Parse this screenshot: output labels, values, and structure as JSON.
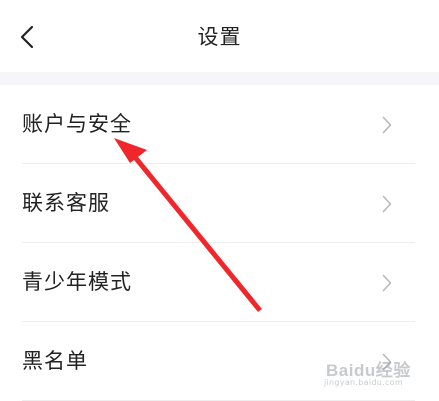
{
  "header": {
    "title": "设置",
    "back_icon": "chevron-left-icon"
  },
  "list": {
    "items": [
      {
        "label": "账户与安全",
        "icon": "chevron-right-icon"
      },
      {
        "label": "联系客服",
        "icon": "chevron-right-icon"
      },
      {
        "label": "青少年模式",
        "icon": "chevron-right-icon"
      },
      {
        "label": "黑名单",
        "icon": "chevron-right-icon"
      }
    ]
  },
  "annotation": {
    "color": "#f0262a"
  },
  "watermark": {
    "brand": "Baidu经验",
    "site": "jingyan.baidu.com"
  },
  "colors": {
    "text": "#222222",
    "chevron": "#b8b8b8",
    "divider": "#eeeeee",
    "section_gap": "#f6f6f8"
  }
}
